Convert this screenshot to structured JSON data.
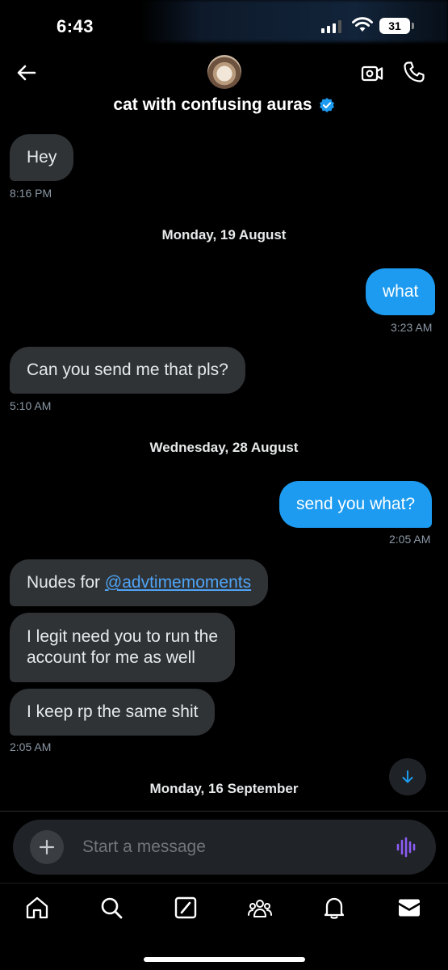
{
  "status_bar": {
    "time": "6:43",
    "battery": "31"
  },
  "header": {
    "title": "cat with confusing auras",
    "avatar": "cat-avatar",
    "verified_color": "#1d9bf0"
  },
  "messages": [
    {
      "kind": "in",
      "text": "Hey",
      "time": "8:16 PM"
    },
    {
      "kind": "date",
      "text": "Monday, 19 August"
    },
    {
      "kind": "out",
      "text": "what",
      "time": "3:23 AM"
    },
    {
      "kind": "in",
      "text": "Can you send me that pls?",
      "time": "5:10 AM"
    },
    {
      "kind": "date",
      "text": "Wednesday, 28 August"
    },
    {
      "kind": "out",
      "text": "send you what?",
      "time": "2:05 AM"
    },
    {
      "kind": "in",
      "text_prefix": "Nudes for ",
      "mention": "@advtimemoments"
    },
    {
      "kind": "in",
      "text_line1": "I legit need you to run the",
      "text_line2": "account for me as well"
    },
    {
      "kind": "in",
      "text": "I keep rp the same shit",
      "time": "2:05 AM"
    },
    {
      "kind": "date",
      "text": "Monday, 16 September"
    }
  ],
  "composer": {
    "placeholder": "Start a message"
  },
  "colors": {
    "accent": "#1d9bf0",
    "incoming_bubble": "#2f3336",
    "voice_icon": "#8b5cf6"
  },
  "tabbar": [
    "home-icon",
    "search-icon",
    "grok-icon",
    "communities-icon",
    "notifications-icon",
    "messages-icon"
  ]
}
